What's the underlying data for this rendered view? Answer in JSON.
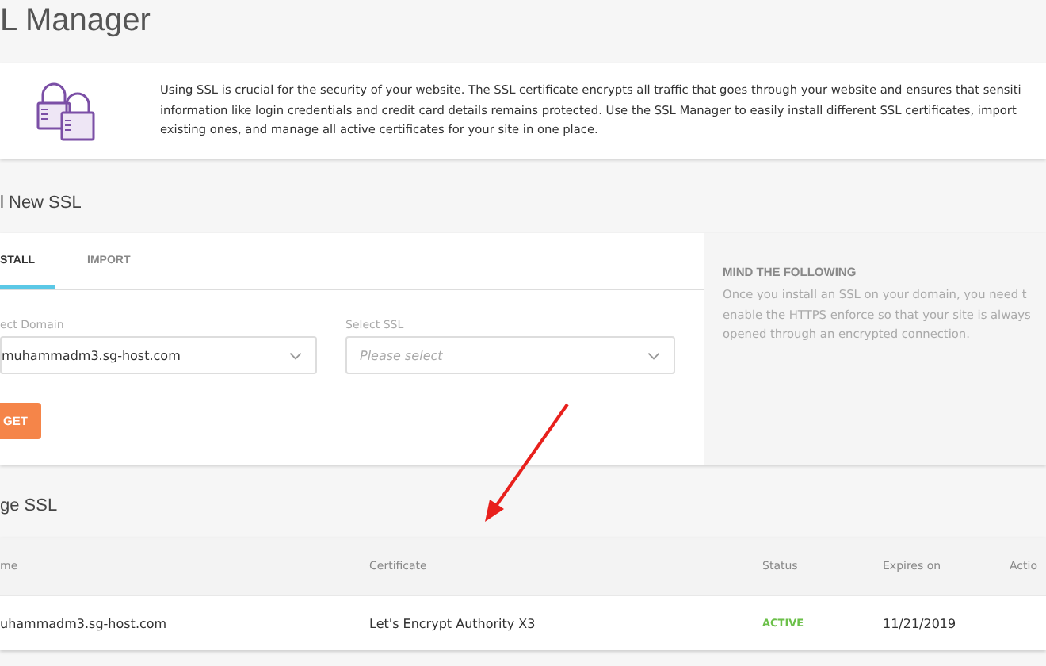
{
  "page_title": "L Manager",
  "info": {
    "lines": [
      "Using SSL is crucial for the security of your website. The SSL certificate encrypts all traffic that goes through your website and ensures that sensiti",
      "information like login credentials and credit card details remains protected. Use the SSL Manager to easily install different SSL certificates, import",
      "existing ones, and manage all active certificates for your site in one place."
    ]
  },
  "new_ssl": {
    "title": "l New SSL",
    "tabs": [
      {
        "label": "STALL",
        "selected": true
      },
      {
        "label": "IMPORT",
        "selected": false
      }
    ],
    "fields": [
      {
        "label": "ect Domain",
        "value": "muhammadm3.sg-host.com"
      },
      {
        "label": "Select SSL",
        "placeholder": "Please select"
      }
    ],
    "button": "GET",
    "note": {
      "title": "MIND THE FOLLOWING",
      "lines": [
        "Once you install an SSL on your domain, you need t",
        "enable the HTTPS enforce so that your site is always",
        "opened through an encrypted connection."
      ]
    }
  },
  "manage_ssl": {
    "title": "ge SSL",
    "table": {
      "columns": [
        "me",
        "Certificate",
        "Status",
        "Expires on",
        "Actio"
      ],
      "rows": [
        {
          "name": "uhammadm3.sg-host.com",
          "certificate": "Let's Encrypt Authority X3",
          "status": "ACTIVE",
          "expires": "11/21/2019"
        }
      ]
    }
  }
}
